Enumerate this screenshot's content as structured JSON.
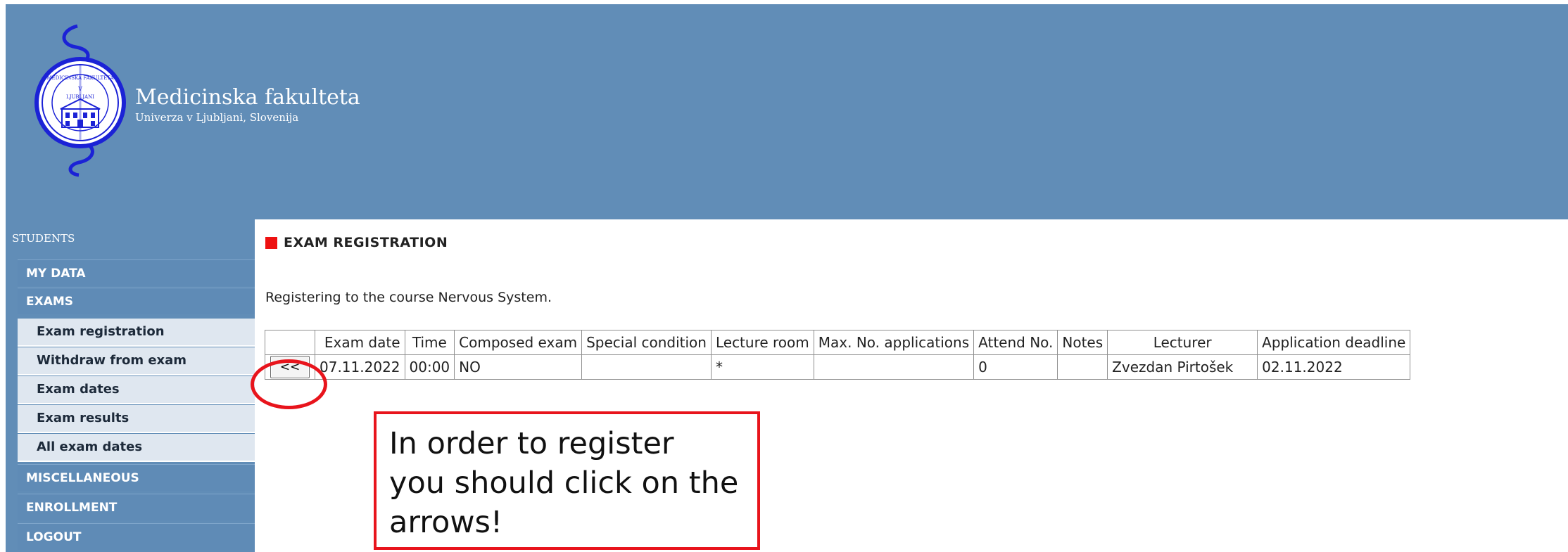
{
  "header": {
    "title": "Medicinska fakulteta",
    "subtitle": "Univerza v Ljubljani, Slovenija",
    "seal_text": [
      "MEDICINSKA FAKULTETA",
      "V",
      "LJUBLJANI"
    ],
    "background_color": "#618db7",
    "logo_icon": "faculty-seal-caduceus-icon"
  },
  "sidebar": {
    "heading": "STUDENTS",
    "menu": [
      {
        "label": "MY DATA",
        "type": "main"
      },
      {
        "label": "EXAMS",
        "type": "main"
      },
      {
        "label": "Exam registration",
        "type": "sub"
      },
      {
        "label": "Withdraw from exam",
        "type": "sub"
      },
      {
        "label": "Exam dates",
        "type": "sub"
      },
      {
        "label": "Exam results",
        "type": "sub"
      },
      {
        "label": "All exam dates",
        "type": "sub"
      },
      {
        "label": "MISCELLANEOUS",
        "type": "main"
      },
      {
        "label": "ENROLLMENT",
        "type": "main"
      },
      {
        "label": "LOGOUT",
        "type": "main"
      }
    ]
  },
  "main": {
    "section_title": "EXAM REGISTRATION",
    "section_marker_color": "#ee1111",
    "intro": "Registering to the course Nervous System.",
    "table": {
      "headers": [
        "",
        "Exam date",
        "Time",
        "Composed exam",
        "Special condition",
        "Lecture room",
        "Max. No. applications",
        "Attend No.",
        "Notes",
        "Lecturer",
        "Application deadline"
      ],
      "rows": [
        {
          "action_label": "<<",
          "exam_date": "07.11.2022",
          "time": "00:00",
          "composed_exam": "NO",
          "special_condition": "",
          "lecture_room": "*",
          "max_applications": "",
          "attend_no": "0",
          "notes": "",
          "lecturer": "Zvezdan Pirtošek",
          "application_deadline": "02.11.2022"
        }
      ]
    }
  },
  "annotation": {
    "callout_lines": [
      "In order to register",
      "you should click on the",
      "arrows!"
    ],
    "accent_color": "#e8141c"
  }
}
